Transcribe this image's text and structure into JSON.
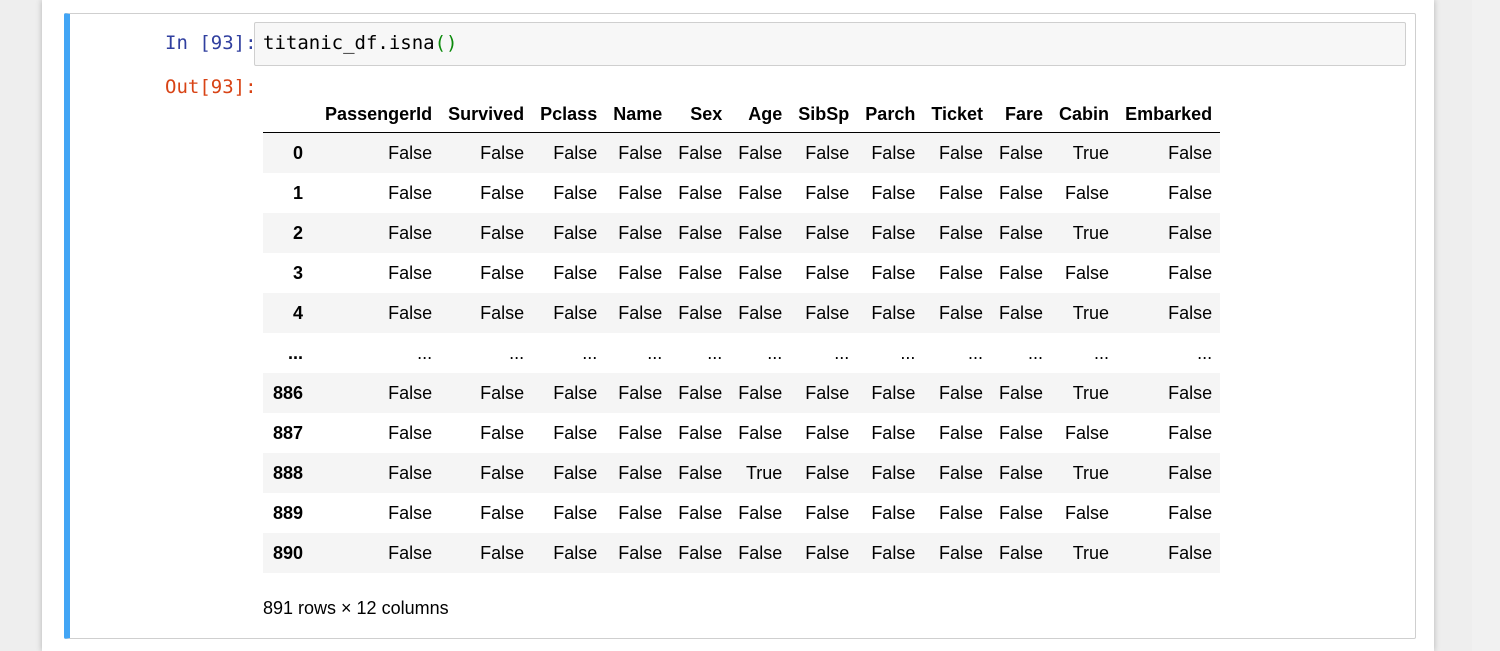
{
  "cell": {
    "in_prompt": "In [93]:",
    "out_prompt": "Out[93]:",
    "code_object": "titanic_df.isna",
    "code_parens": "()"
  },
  "table": {
    "columns": [
      "",
      "PassengerId",
      "Survived",
      "Pclass",
      "Name",
      "Sex",
      "Age",
      "SibSp",
      "Parch",
      "Ticket",
      "Fare",
      "Cabin",
      "Embarked"
    ],
    "rows": [
      [
        "0",
        "False",
        "False",
        "False",
        "False",
        "False",
        "False",
        "False",
        "False",
        "False",
        "False",
        "True",
        "False"
      ],
      [
        "1",
        "False",
        "False",
        "False",
        "False",
        "False",
        "False",
        "False",
        "False",
        "False",
        "False",
        "False",
        "False"
      ],
      [
        "2",
        "False",
        "False",
        "False",
        "False",
        "False",
        "False",
        "False",
        "False",
        "False",
        "False",
        "True",
        "False"
      ],
      [
        "3",
        "False",
        "False",
        "False",
        "False",
        "False",
        "False",
        "False",
        "False",
        "False",
        "False",
        "False",
        "False"
      ],
      [
        "4",
        "False",
        "False",
        "False",
        "False",
        "False",
        "False",
        "False",
        "False",
        "False",
        "False",
        "True",
        "False"
      ],
      [
        "...",
        "...",
        "...",
        "...",
        "...",
        "...",
        "...",
        "...",
        "...",
        "...",
        "...",
        "...",
        "..."
      ],
      [
        "886",
        "False",
        "False",
        "False",
        "False",
        "False",
        "False",
        "False",
        "False",
        "False",
        "False",
        "True",
        "False"
      ],
      [
        "887",
        "False",
        "False",
        "False",
        "False",
        "False",
        "False",
        "False",
        "False",
        "False",
        "False",
        "False",
        "False"
      ],
      [
        "888",
        "False",
        "False",
        "False",
        "False",
        "False",
        "True",
        "False",
        "False",
        "False",
        "False",
        "True",
        "False"
      ],
      [
        "889",
        "False",
        "False",
        "False",
        "False",
        "False",
        "False",
        "False",
        "False",
        "False",
        "False",
        "False",
        "False"
      ],
      [
        "890",
        "False",
        "False",
        "False",
        "False",
        "False",
        "False",
        "False",
        "False",
        "False",
        "False",
        "True",
        "False"
      ]
    ]
  },
  "summary": "891 rows × 12 columns",
  "colors": {
    "cell_accent": "#42a5f5",
    "in_prompt": "#303f9f",
    "out_prompt": "#d84315",
    "paren": "#0b8a0b"
  }
}
